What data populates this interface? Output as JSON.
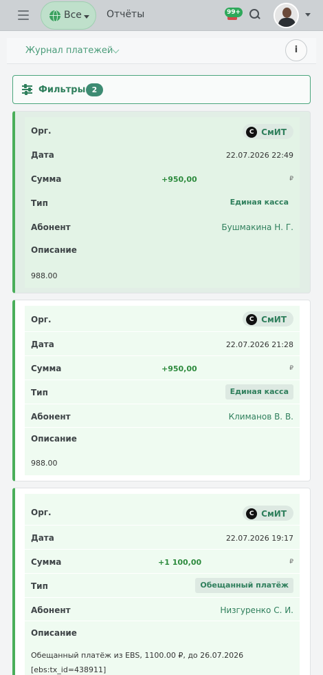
{
  "topbar": {
    "scope_label": "Все",
    "reports_label": "Отчёты",
    "notifications_count": "99+"
  },
  "page": {
    "title": "Журнал платежей",
    "info_label": "i"
  },
  "filters": {
    "label": "Фильтры",
    "count": "2"
  },
  "labels": {
    "org": "Орг.",
    "date": "Дата",
    "amount": "Сумма",
    "type": "Тип",
    "subscriber": "Абонент",
    "description": "Описание",
    "currency": "₽"
  },
  "payments": [
    {
      "org_logo": "C",
      "org": "СмИТ",
      "date": "22.07.2026 22:49",
      "amount": "+950,00",
      "type": "Единая касса",
      "subscriber": "Бушмакина Н. Г.",
      "description": "988.00"
    },
    {
      "org_logo": "C",
      "org": "СмИТ",
      "date": "22.07.2026 21:28",
      "amount": "+950,00",
      "type": "Единая касса",
      "subscriber": "Климанов В. В.",
      "description": "988.00"
    },
    {
      "org_logo": "C",
      "org": "СмИТ",
      "date": "22.07.2026 19:17",
      "amount": "+1 100,00",
      "type": "Обещанный платёж",
      "subscriber": "Низгуренко С. И.",
      "description_line1": "Обещанный платёж из EBS, 1100.00 ₽, до 26.07.2026",
      "description_line2": "[ebs:tx_id=438911]"
    }
  ]
}
